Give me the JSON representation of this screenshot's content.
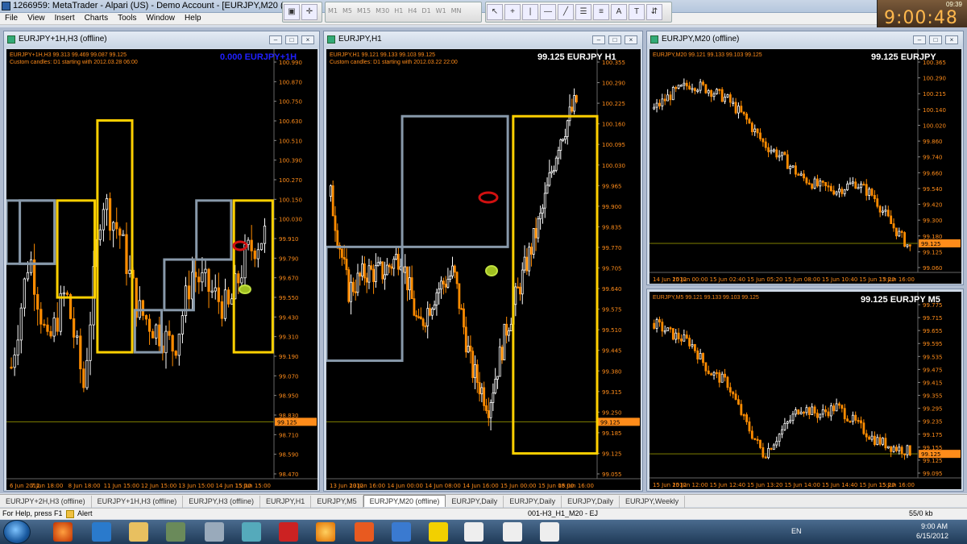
{
  "window": {
    "title": "1266959: MetaTrader - Alpari (US) - Demo Account - [EURJPY,M20 (offline)]"
  },
  "menu": [
    "File",
    "View",
    "Insert",
    "Charts",
    "Tools",
    "Window",
    "Help"
  ],
  "timeframes": [
    "M1",
    "M5",
    "M15",
    "M30",
    "H1",
    "H4",
    "D1",
    "W1",
    "MN"
  ],
  "clock": {
    "time": "9:00:48",
    "small": "09:39"
  },
  "charts": [
    {
      "caption": "EURJPY+1H,H3 (offline)",
      "info": "EURJPY+1H,H3  99.313 99.469 99.087 99.125",
      "note": "Custom candles: D1 starting with 2012.03.28 06:00",
      "big": "0.000 EURJPY+1H",
      "big_color": "#2020ff",
      "price_labels": [
        "100.990",
        "100.870",
        "100.750",
        "100.630",
        "100.510",
        "100.390",
        "100.270",
        "100.150",
        "100.030",
        "99.910",
        "99.790",
        "99.670",
        "99.550",
        "99.430",
        "99.310",
        "99.190",
        "99.070",
        "98.950",
        "98.830",
        "98.710",
        "98.590",
        "98.470"
      ],
      "current_price": "99.125",
      "time_labels": [
        "6 Jun 2012",
        "7 Jun 18:00",
        "8 Jun 18:00",
        "11 Jun 15:00",
        "12 Jun 15:00",
        "13 Jun 15:00",
        "14 Jun 15:00",
        "15 Jun 15:00"
      ]
    },
    {
      "caption": "EURJPY,H1",
      "info": "EURJPY,H1  99.121 99.133 99.103 99.125",
      "note": "Custom candles: D1 starting with 2012.03.22 22:00",
      "big": "99.125 EURJPY H1",
      "big_color": "#ffffff",
      "price_labels": [
        "100.355",
        "100.290",
        "100.225",
        "100.160",
        "100.095",
        "100.030",
        "99.965",
        "99.900",
        "99.835",
        "99.770",
        "99.705",
        "99.640",
        "99.575",
        "99.510",
        "99.445",
        "99.380",
        "99.315",
        "99.250",
        "99.185",
        "99.125",
        "99.055"
      ],
      "current_price": "99.125",
      "time_labels": [
        "13 Jun 2012",
        "13 Jun 16:00",
        "14 Jun 00:00",
        "14 Jun 08:00",
        "14 Jun 16:00",
        "15 Jun 00:00",
        "15 Jun 08:00",
        "15 Jun 16:00"
      ]
    },
    {
      "caption": "EURJPY,M20 (offline)",
      "info": "EURJPY,M20  99.121 99.133 99.103 99.125",
      "note": "",
      "big": "99.125 EURJPY",
      "big_color": "#ffffff",
      "price_labels": [
        "100.365",
        "100.290",
        "100.215",
        "100.140",
        "100.020",
        "99.860",
        "99.740",
        "99.660",
        "99.540",
        "99.420",
        "99.300",
        "99.180",
        "99.125",
        "99.060"
      ],
      "current_price": "99.125",
      "time_labels": [
        "14 Jun 2012",
        "15 Jun 00:00",
        "15 Jun 02:40",
        "15 Jun 05:20",
        "15 Jun 08:00",
        "15 Jun 10:40",
        "15 Jun 13:20",
        "15 Jun 16:00"
      ]
    },
    {
      "caption": "EURJPY,M5",
      "info": "EURJPY,M5  99.121 99.133 99.103 99.125",
      "note": "",
      "big": "99.125 EURJPY M5",
      "big_color": "#ffffff",
      "price_labels": [
        "99.775",
        "99.715",
        "99.655",
        "99.595",
        "99.535",
        "99.475",
        "99.415",
        "99.355",
        "99.295",
        "99.235",
        "99.175",
        "99.155",
        "99.125",
        "99.095"
      ],
      "current_price": "99.125",
      "time_labels": [
        "15 Jun 2012",
        "15 Jun 12:00",
        "15 Jun 12:40",
        "15 Jun 13:20",
        "15 Jun 14:00",
        "15 Jun 14:40",
        "15 Jun 15:20",
        "15 Jun 16:00"
      ]
    }
  ],
  "tabs": [
    "EURJPY+2H,H3 (offline)",
    "EURJPY+1H,H3 (offline)",
    "EURJPY,H3 (offline)",
    "EURJPY,H1",
    "EURJPY,M5",
    "EURJPY,M20 (offline)",
    "EURJPY,Daily",
    "EURJPY,Daily",
    "EURJPY,Daily",
    "EURJPY,Weekly"
  ],
  "status": {
    "help": "For Help, press F1",
    "alert": "Alert",
    "profile": "001-H3_H1_M20 - EJ",
    "traffic": "55/0 kb"
  },
  "tray": {
    "lang": "EN",
    "time": "9:00 AM",
    "date": "6/15/2012"
  },
  "colors": {
    "bull": "#ffffff",
    "bear": "#ff8c00",
    "box_gray": "#8899aa",
    "box_yellow": "#ffd000",
    "grid": "#808000"
  }
}
